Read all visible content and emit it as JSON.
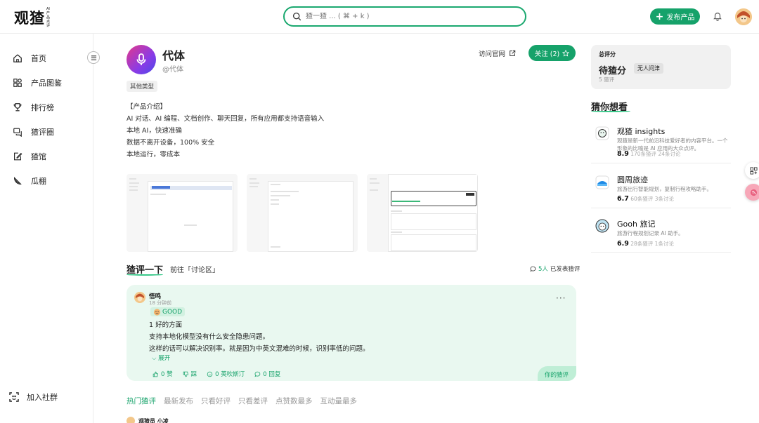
{
  "header": {
    "logo": "观猹",
    "logo_small": "AI产品点评",
    "search_placeholder": "猹一猹 ... ( ⌘ + k )",
    "publish_label": "发布产品"
  },
  "sidebar": {
    "items": [
      {
        "label": "首页",
        "icon": "home-icon"
      },
      {
        "label": "产品图鉴",
        "icon": "grid-icon"
      },
      {
        "label": "排行榜",
        "icon": "trophy-icon"
      },
      {
        "label": "猹评圈",
        "icon": "chat-icon"
      },
      {
        "label": "猹馆",
        "icon": "edit-icon"
      },
      {
        "label": "瓜棚",
        "icon": "melon-icon"
      }
    ],
    "join_label": "加入社群"
  },
  "product": {
    "name": "代体",
    "handle": "@代体",
    "tag": "其他类型",
    "visit_label": "访问官网",
    "follow_label": "关注 (2)",
    "description": [
      "【产品介绍】",
      "AI 对话、AI 编程、文档创作、聊天回复，所有应用都支持语音输入",
      "本地 AI，快速准确",
      "数据不离开设备，100% 安全",
      "本地运行，零成本"
    ]
  },
  "reviews": {
    "title": "猹评一下",
    "goto_label": "前往「讨论区」",
    "count_num": "5人",
    "count_suffix": "已发表猹评",
    "card": {
      "user": "悟鸣",
      "time": "18 分钟前",
      "badge": "GOOD",
      "lines": [
        "1 好的方面",
        "支持本地化模型没有什么安全隐患问题。",
        "这样的话可以解决识别率。就是因为中英文混难的时候，识别率低的问题。"
      ],
      "expand_label": "展开",
      "actions": [
        "0 赞",
        "踩",
        "0 英吹斯汀",
        "0 回复"
      ],
      "your_review": "你的猹评"
    },
    "sort_tabs": [
      "热门猹评",
      "最新发布",
      "只看好评",
      "只看差评",
      "点赞数最多",
      "互动量最多"
    ],
    "next_user": "观猹员 小凌"
  },
  "score": {
    "label": "总评分",
    "value": "待猹分",
    "badge": "无人问津",
    "sub": "5 猹评"
  },
  "guess": {
    "title": "猜你想看",
    "items": [
      {
        "name": "观猹 insights",
        "desc": "观猹是新一代前沿科技爱好者的内容平台。一个形象的比喻是 AI 应用的大众点评。",
        "score": "8.9",
        "reviews": "170条猹评",
        "discuss": "24条讨论"
      },
      {
        "name": "圆周旅迹",
        "desc": "旅游出行智能规划，复制行程攻略助手。",
        "score": "6.7",
        "reviews": "60条猹评",
        "discuss": "3条讨论"
      },
      {
        "name": "Gooh 旅记",
        "desc": "旅游行程规划记录 AI 助手。",
        "score": "6.9",
        "reviews": "28条猹评",
        "discuss": "1条讨论"
      }
    ]
  },
  "colors": {
    "accent": "#16a26a",
    "card_bg": "#e9f8f0"
  }
}
